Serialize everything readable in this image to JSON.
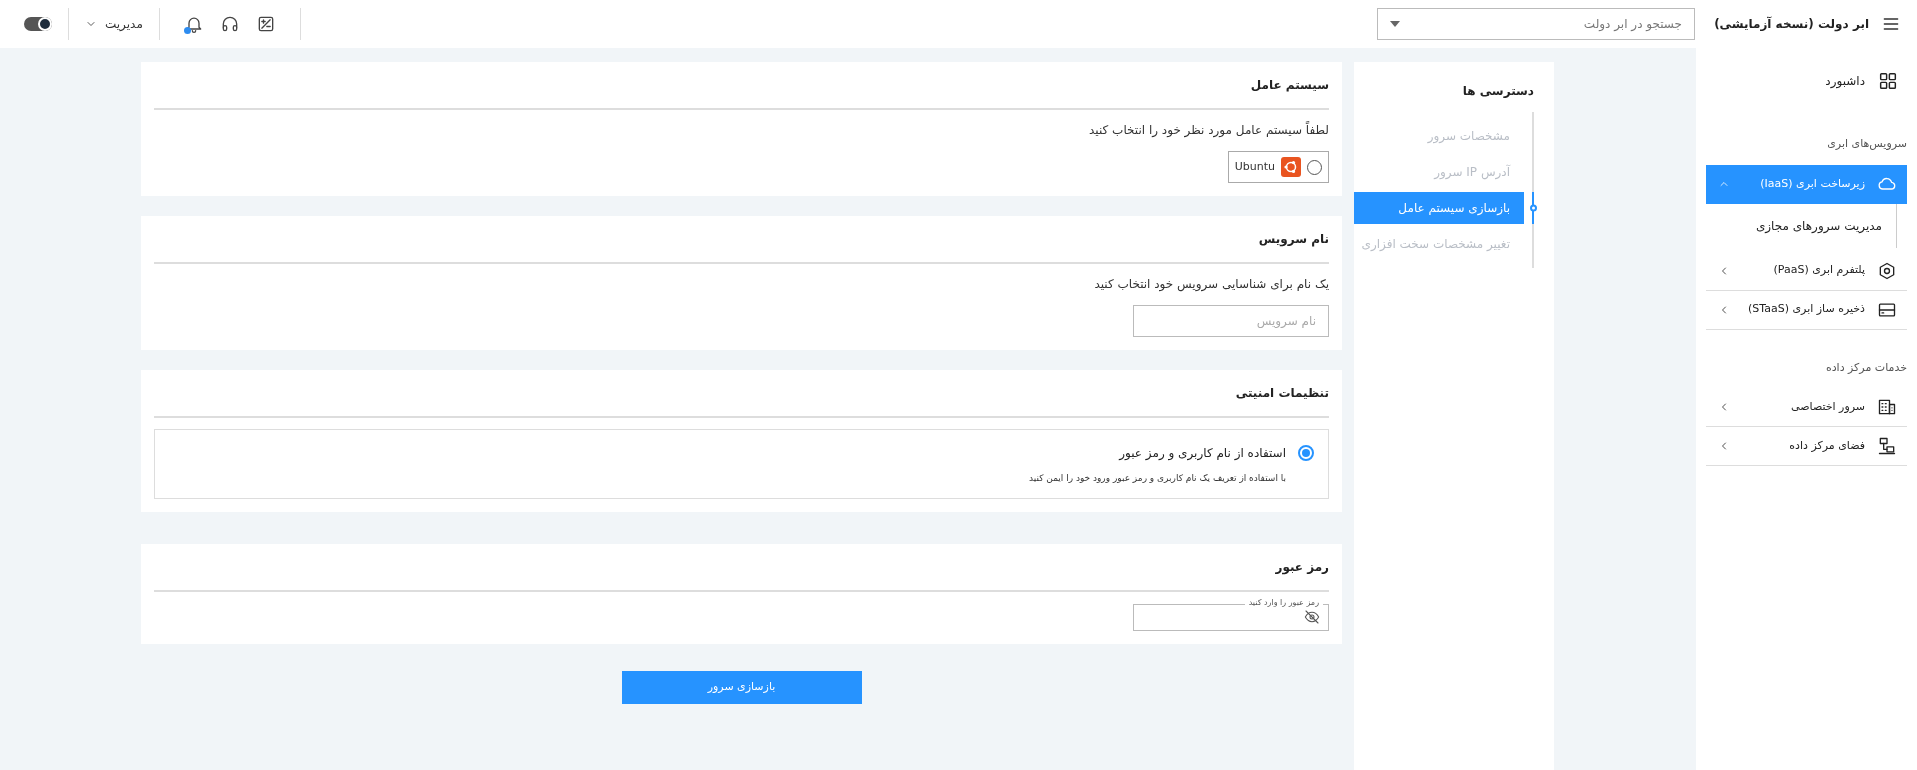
{
  "header": {
    "title": "ابر دولت (نسخه آزمایشی)",
    "search": {
      "placeholder": "جستجو در ابر دولت"
    },
    "user_menu": {
      "label": "مدیریت"
    },
    "notifications": {
      "unread": true
    },
    "theme_toggle": {
      "on": true
    }
  },
  "sidebar": {
    "dashboard": {
      "label": "داشبورد"
    },
    "sections": [
      {
        "title": "سرویس‌های ابری",
        "items": [
          {
            "label": "زیرساخت ابری (IaaS)",
            "selected": true,
            "expanded": true,
            "children": [
              {
                "label": "مدیریت سرورهای مجازی"
              }
            ]
          },
          {
            "label": "پلتفرم ابری (PaaS)",
            "selected": false,
            "expanded": false
          },
          {
            "label": "ذخیره ساز ابری (STaaS)",
            "selected": false,
            "expanded": false
          }
        ]
      },
      {
        "title": "خدمات مرکز داده",
        "items": [
          {
            "label": "سرور اختصاصی",
            "selected": false,
            "expanded": false
          },
          {
            "label": "فضای مرکز داده",
            "selected": false,
            "expanded": false
          }
        ]
      }
    ]
  },
  "steps": {
    "title": "دسترسی ها",
    "items": [
      {
        "label": "مشخصات سرور",
        "selected": false
      },
      {
        "label": "آدرس IP سرور",
        "selected": false
      },
      {
        "label": "بازسازی سیستم عامل",
        "selected": true
      },
      {
        "label": "تغییر مشخصات سخت افزاری",
        "selected": false
      }
    ]
  },
  "cards": [
    {
      "kind": "os",
      "title": "سیستم عامل",
      "description": "لطفاً سیستم عامل مورد نظر خود را انتخاب کنید",
      "options": [
        {
          "label": "Ubuntu",
          "selected": false
        }
      ]
    },
    {
      "kind": "name",
      "title": "نام سرویس",
      "description": "یک نام برای شناسایی سرویس خود انتخاب کنید",
      "placeholder": "نام سرویس"
    },
    {
      "kind": "security",
      "title": "تنظیمات امنیتی",
      "options": [
        {
          "label": "استفاده از نام کاربری و رمز عبور",
          "description": "با استفاده از تعریف یک نام کاربری و رمز عبور ورود خود را ایمن کنید",
          "selected": true
        }
      ]
    },
    {
      "kind": "password",
      "title": "رمز عبور",
      "field_label": "رمز عبور را وارد کنید"
    }
  ],
  "submit": {
    "label": "بازسازی سرور"
  }
}
